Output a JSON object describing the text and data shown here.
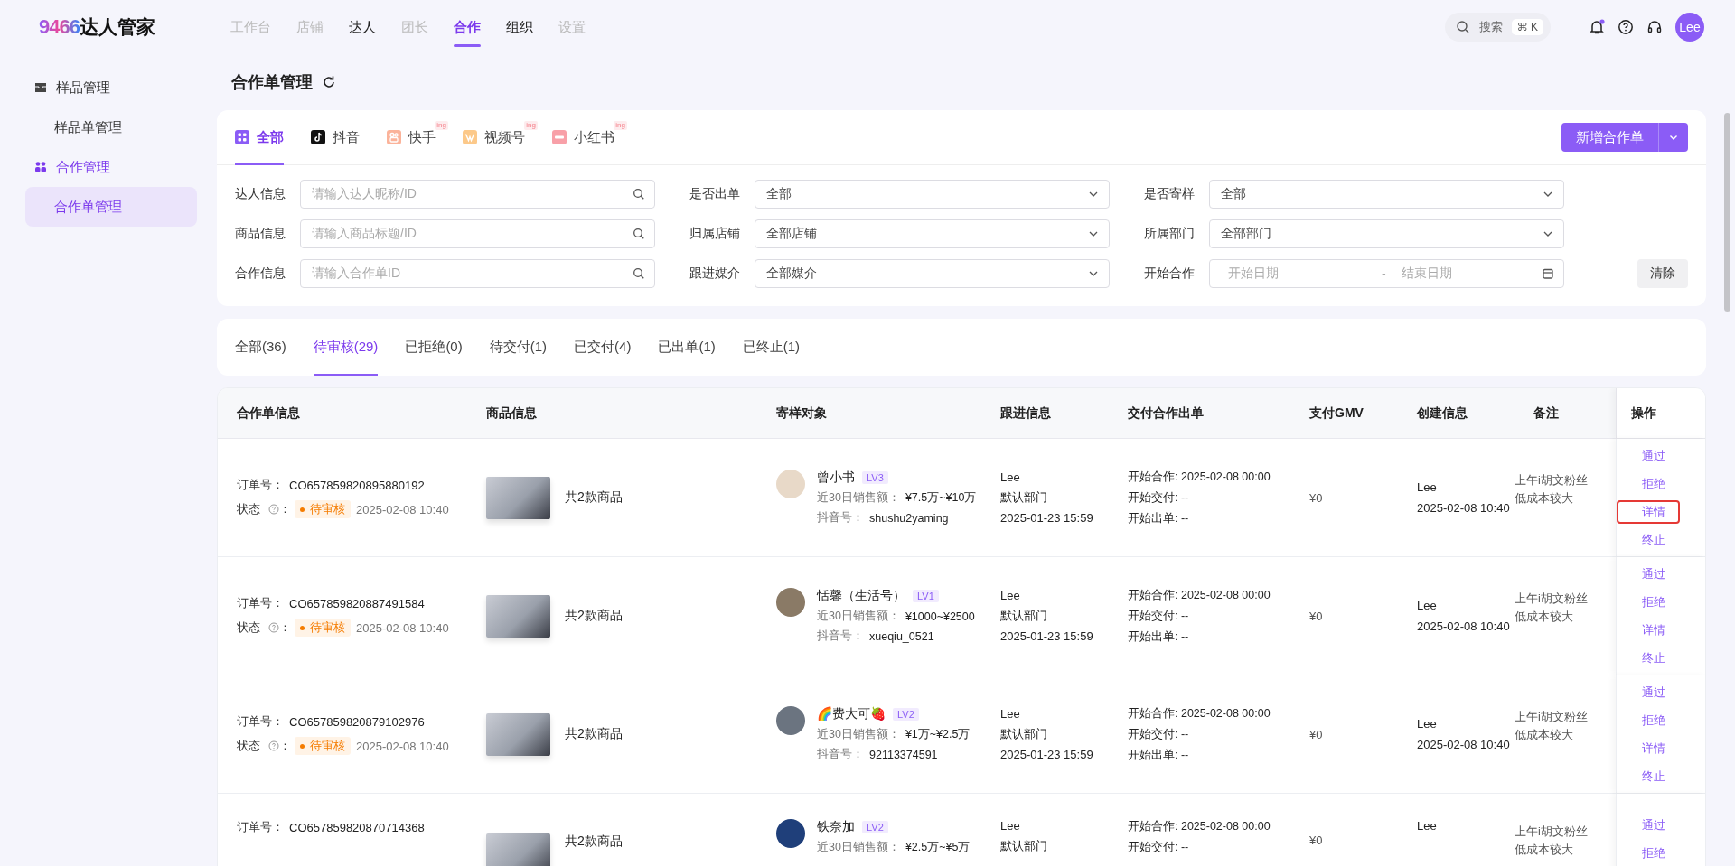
{
  "header": {
    "logo_number": "9466",
    "logo_text": "达人管家",
    "nav": [
      {
        "label": "工作台",
        "selected": false,
        "disabled": true
      },
      {
        "label": "店铺",
        "selected": false,
        "disabled": true
      },
      {
        "label": "达人",
        "selected": false,
        "disabled": false
      },
      {
        "label": "团长",
        "selected": false,
        "disabled": true
      },
      {
        "label": "合作",
        "selected": true,
        "disabled": false
      },
      {
        "label": "组织",
        "selected": false,
        "disabled": false
      },
      {
        "label": "设置",
        "selected": false,
        "disabled": true
      }
    ],
    "search": {
      "placeholder": "搜索",
      "shortcut": "⌘ K"
    },
    "has_unread": true,
    "avatar": "Lee"
  },
  "sidebar": {
    "groups": [
      {
        "label": "样品管理",
        "kind": "sample",
        "active": false,
        "children": [
          {
            "label": "样品单管理",
            "selected": false
          }
        ]
      },
      {
        "label": "合作管理",
        "kind": "cooperation",
        "active": true,
        "children": [
          {
            "label": "合作单管理",
            "selected": true
          }
        ]
      }
    ]
  },
  "page_title": "合作单管理",
  "platform_tabs": [
    {
      "label": "全部",
      "kind": "all",
      "selected": true
    },
    {
      "label": "抖音",
      "kind": "douyin",
      "selected": false
    },
    {
      "label": "快手",
      "kind": "kuaishou",
      "selected": false,
      "badge": "ing"
    },
    {
      "label": "视频号",
      "kind": "shipinhao",
      "selected": false,
      "badge": "ing"
    },
    {
      "label": "小红书",
      "kind": "xiaohongshu",
      "selected": false,
      "badge": "ing"
    }
  ],
  "new_button": "新增合作单",
  "filters": [
    {
      "label": "达人信息",
      "kind": "search",
      "placeholder": "请输入达人昵称/ID"
    },
    {
      "label": "是否出单",
      "kind": "select",
      "value": "全部"
    },
    {
      "label": "是否寄样",
      "kind": "select",
      "value": "全部"
    },
    {
      "label": "商品信息",
      "kind": "search",
      "placeholder": "请输入商品标题/ID"
    },
    {
      "label": "归属店铺",
      "kind": "select",
      "value": "全部店铺"
    },
    {
      "label": "所属部门",
      "kind": "select",
      "value": "全部部门"
    },
    {
      "label": "合作信息",
      "kind": "search",
      "placeholder": "请输入合作单ID"
    },
    {
      "label": "跟进媒介",
      "kind": "select",
      "value": "全部媒介"
    },
    {
      "label": "开始合作",
      "kind": "daterange",
      "start_placeholder": "开始日期",
      "separator": "-",
      "end_placeholder": "结束日期"
    }
  ],
  "clear_button": "清除",
  "status_tabs": [
    {
      "label": "全部(36)",
      "selected": false
    },
    {
      "label": "待审核(29)",
      "selected": true
    },
    {
      "label": "已拒绝(0)",
      "selected": false
    },
    {
      "label": "待交付(1)",
      "selected": false
    },
    {
      "label": "已交付(4)",
      "selected": false
    },
    {
      "label": "已出单(1)",
      "selected": false
    },
    {
      "label": "已终止(1)",
      "selected": false
    }
  ],
  "table": {
    "columns": [
      "合作单信息",
      "商品信息",
      "寄样对象",
      "跟进信息",
      "交付合作出单",
      "支付GMV",
      "创建信息",
      "备注",
      "操作"
    ],
    "rows": [
      {
        "order_label": "订单号：",
        "order_no": "CO657859820895880192",
        "status_label": "状态",
        "status_colon": "：",
        "status": "待审核",
        "status_time": "2025-02-08 10:40",
        "products": "共2款商品",
        "influencer": {
          "name": "曾小书",
          "level": "LV3",
          "sales_label": "近30日销售额：",
          "sales": "¥7.5万~¥10万",
          "account_label": "抖音号：",
          "account": "shushu2yaming"
        },
        "follow": [
          "Lee",
          "默认部门",
          "2025-01-23 15:59"
        ],
        "delivery": [
          "开始合作: 2025-02-08 00:00",
          "开始交付: --",
          "开始出单: --"
        ],
        "gmv": "¥0",
        "created": [
          "Lee",
          "2025-02-08 10:40"
        ],
        "remark": [
          "上午i胡文粉丝",
          "低成本较大"
        ],
        "actions": [
          {
            "label": "通过",
            "highlighted": false
          },
          {
            "label": "拒绝",
            "highlighted": false
          },
          {
            "label": "详情",
            "highlighted": true
          },
          {
            "label": "终止",
            "highlighted": false
          }
        ]
      },
      {
        "order_label": "订单号：",
        "order_no": "CO657859820887491584",
        "status_label": "状态",
        "status_colon": "：",
        "status": "待审核",
        "status_time": "2025-02-08 10:40",
        "products": "共2款商品",
        "influencer": {
          "name": "恬馨（生活号）",
          "level": "LV1",
          "sales_label": "近30日销售额：",
          "sales": "¥1000~¥2500",
          "account_label": "抖音号：",
          "account": "xueqiu_0521"
        },
        "follow": [
          "Lee",
          "默认部门",
          "2025-01-23 15:59"
        ],
        "delivery": [
          "开始合作: 2025-02-08 00:00",
          "开始交付: --",
          "开始出单: --"
        ],
        "gmv": "¥0",
        "created": [
          "Lee",
          "2025-02-08 10:40"
        ],
        "remark": [
          "上午i胡文粉丝",
          "低成本较大"
        ],
        "actions": [
          {
            "label": "通过",
            "highlighted": false
          },
          {
            "label": "拒绝",
            "highlighted": false
          },
          {
            "label": "详情",
            "highlighted": false
          },
          {
            "label": "终止",
            "highlighted": false
          }
        ]
      },
      {
        "order_label": "订单号：",
        "order_no": "CO657859820879102976",
        "status_label": "状态",
        "status_colon": "：",
        "status": "待审核",
        "status_time": "2025-02-08 10:40",
        "products": "共2款商品",
        "influencer": {
          "name": "🌈费大可🍓",
          "level": "LV2",
          "sales_label": "近30日销售额：",
          "sales": "¥1万~¥2.5万",
          "account_label": "抖音号：",
          "account": "92113374591"
        },
        "follow": [
          "Lee",
          "默认部门",
          "2025-01-23 15:59"
        ],
        "delivery": [
          "开始合作: 2025-02-08 00:00",
          "开始交付: --",
          "开始出单: --"
        ],
        "gmv": "¥0",
        "created": [
          "Lee",
          "2025-02-08 10:40"
        ],
        "remark": [
          "上午i胡文粉丝",
          "低成本较大"
        ],
        "actions": [
          {
            "label": "通过",
            "highlighted": false
          },
          {
            "label": "拒绝",
            "highlighted": false
          },
          {
            "label": "详情",
            "highlighted": false
          },
          {
            "label": "终止",
            "highlighted": false
          }
        ]
      },
      {
        "order_label": "订单号：",
        "order_no": "CO657859820870714368",
        "products": "共2款商品",
        "influencer": {
          "name": "铁奈加",
          "level": "LV2",
          "sales_label": "近30日销售额：",
          "sales": "¥2.5万~¥5万"
        },
        "follow": [
          "Lee",
          "默认部门"
        ],
        "delivery": [
          "开始合作: 2025-02-08 00:00",
          "开始交付: --"
        ],
        "gmv": "¥0",
        "created": [
          "Lee"
        ],
        "remark": [
          "上午i胡文粉丝",
          "低成本较大"
        ],
        "actions": [
          {
            "label": "通过",
            "highlighted": false
          },
          {
            "label": "拒绝",
            "highlighted": false
          }
        ]
      }
    ]
  }
}
